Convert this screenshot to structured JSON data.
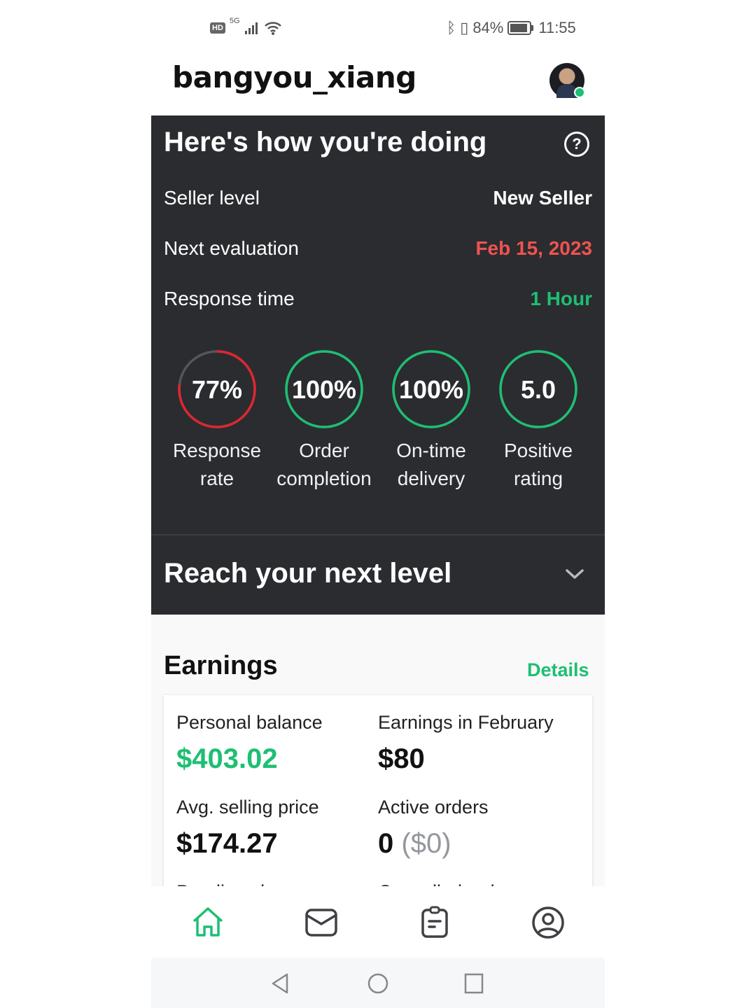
{
  "status_bar": {
    "left_icons": [
      "hd-icon",
      "5g-signal-icon",
      "wifi-icon"
    ],
    "network": "5G",
    "bluetooth": "bluetooth-icon",
    "battery": "84%",
    "time": "11:55"
  },
  "header": {
    "username": "bangyou_xiang",
    "avatar_online": true
  },
  "performance": {
    "title": "Here's how you're doing",
    "rows": [
      {
        "label": "Seller level",
        "value": "New Seller",
        "color": "#ffffff"
      },
      {
        "label": "Next evaluation",
        "value": "Feb 15, 2023",
        "color": "#ef5350"
      },
      {
        "label": "Response time",
        "value": "1 Hour",
        "color": "#1dbf73"
      }
    ],
    "metrics": [
      {
        "value": "77%",
        "line1": "Response",
        "line2": "rate",
        "fraction": 0.77,
        "color": "#e0262f"
      },
      {
        "value": "100%",
        "line1": "Order",
        "line2": "completion",
        "fraction": 1,
        "color": "#1dbf73"
      },
      {
        "value": "100%",
        "line1": "On-time",
        "line2": "delivery",
        "fraction": 1,
        "color": "#1dbf73"
      },
      {
        "value": "5.0",
        "line1": "Positive",
        "line2": "rating",
        "fraction": 1,
        "color": "#1dbf73"
      }
    ],
    "reach_title": "Reach your next level"
  },
  "earnings": {
    "title": "Earnings",
    "details_label": "Details",
    "cells": [
      {
        "label": "Personal balance",
        "value": "$403.02"
      },
      {
        "label": "Earnings in February",
        "value": "$80"
      },
      {
        "label": "Avg. selling price",
        "value": "$174.27"
      },
      {
        "label": "Active orders",
        "value": "0",
        "sub": "($0)"
      },
      {
        "label": "Pending clearance"
      },
      {
        "label": "Cancelled orders"
      }
    ]
  },
  "bottom_nav": [
    {
      "name": "home",
      "active": true
    },
    {
      "name": "inbox"
    },
    {
      "name": "orders"
    },
    {
      "name": "profile"
    }
  ],
  "colors": {
    "accent": "#1dbf73",
    "danger": "#e0262f",
    "card": "#2b2c30"
  }
}
